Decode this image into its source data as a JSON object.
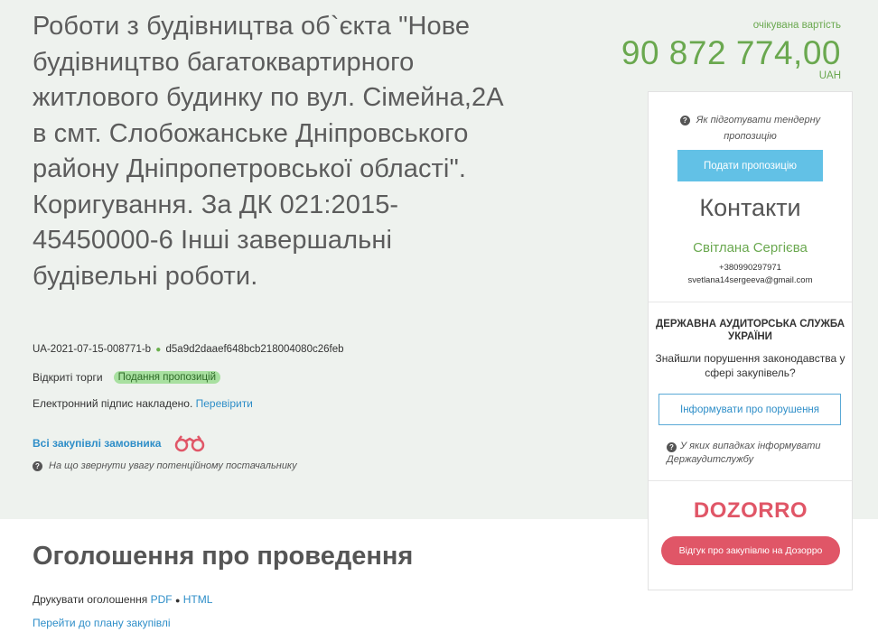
{
  "tender": {
    "title": "Роботи з будівництва об`єкта \"Нове будівництво багатоквартирного житлового будинку по вул. Сімейна,2А в смт. Слобожанське Дніпровського району Дніпропетровської області\". Коригування. За ДК 021:2015-45450000-6 Інші завершальні будівельні роботи.",
    "id": "UA-2021-07-15-008771-b",
    "hash": "d5a9d2daaef648bcb218004080c26feb",
    "procedure": "Відкриті торги",
    "status": "Подання пропозицій",
    "signature_text": "Електронний підпис накладено.",
    "signature_link": "Перевірити",
    "customer_link": "Всі закупівлі замовника",
    "attention_text": "На що звернути увагу потенційному постачальнику"
  },
  "price": {
    "label": "очікувана вартість",
    "value": "90 872 774,00",
    "currency": "UAH"
  },
  "panel": {
    "how_to": "Як підготувати тендерну пропозицію",
    "submit_label": "Подати пропозицію",
    "contacts_title": "Контакти",
    "contact_name": "Світлана Сергієва",
    "contact_phone": "+380990297971",
    "contact_email": "svetlana14sergeeva@gmail.com",
    "audit_title": "ДЕРЖАВНА АУДИТОРСЬКА СЛУЖБА УКРАЇНИ",
    "audit_text": "Знайшли порушення законодавства у сфері закупівель?",
    "report_label": "Інформувати про порушення",
    "audit_note": "У яких випадках інформувати Держаудитслужбу",
    "dozorro_logo": "DOZORRO",
    "dozorro_label": "Відгук про закупівлю на Дозорро"
  },
  "announcement": {
    "title": "Оголошення про проведення",
    "print_text": "Друкувати оголошення",
    "pdf_label": "PDF",
    "sep": "●",
    "html_label": "HTML",
    "plan_link": "Перейти до плану закупівлі"
  },
  "colors": {
    "accent_green": "#6aa84f",
    "link_blue": "#2e8ec8",
    "submit_blue": "#62c1e6",
    "dozorro_red": "#e05667",
    "band_bg": "#eef2ee"
  },
  "icons": [
    "question-icon",
    "binoculars-icon"
  ]
}
